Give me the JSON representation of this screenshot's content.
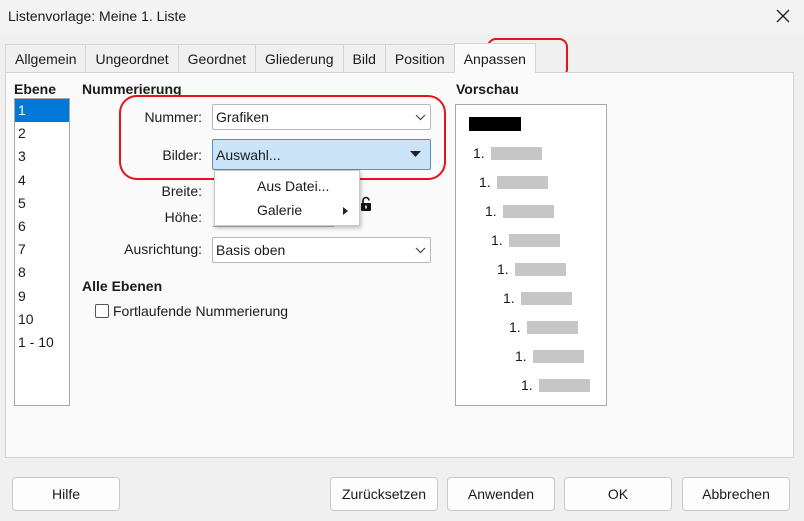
{
  "window": {
    "title": "Listenvorlage: Meine 1. Liste",
    "close_glyph": "✕"
  },
  "tabs": [
    {
      "label": "Allgemein"
    },
    {
      "label": "Ungeordnet"
    },
    {
      "label": "Geordnet"
    },
    {
      "label": "Gliederung"
    },
    {
      "label": "Bild"
    },
    {
      "label": "Position"
    },
    {
      "label": "Anpassen",
      "active": true
    }
  ],
  "ebene": {
    "header": "Ebene",
    "items": [
      "1",
      "2",
      "3",
      "4",
      "5",
      "6",
      "7",
      "8",
      "9",
      "10",
      "1 - 10"
    ],
    "selected": "1"
  },
  "nummerierung": {
    "header": "Nummerierung",
    "nummer_label": "Nummer:",
    "nummer_value": "Grafiken",
    "bilder_label": "Bilder:",
    "bilder_value": "Auswahl...",
    "breite_label": "Breite:",
    "hoehe_label": "Höhe:",
    "ausrichtung_label": "Ausrichtung:",
    "ausrichtung_value": "Basis oben"
  },
  "bilder_menu": {
    "items": [
      {
        "label": "Aus Datei..."
      },
      {
        "label": "Galerie",
        "submenu": true
      }
    ]
  },
  "alle_ebenen": {
    "header": "Alle Ebenen",
    "checkbox_label": "Fortlaufende Nummerierung",
    "checked": false
  },
  "vorschau": {
    "header": "Vorschau",
    "rows": [
      "1.",
      "1.",
      "1.",
      "1.",
      "1.",
      "1.",
      "1.",
      "1.",
      "1."
    ]
  },
  "buttons": {
    "help": "Hilfe",
    "reset": "Zurücksetzen",
    "apply": "Anwenden",
    "ok": "OK",
    "cancel": "Abbrechen"
  },
  "colors": {
    "highlight": "#e3141c",
    "selection": "#0078d7",
    "open_combo": "#cce4f7"
  }
}
